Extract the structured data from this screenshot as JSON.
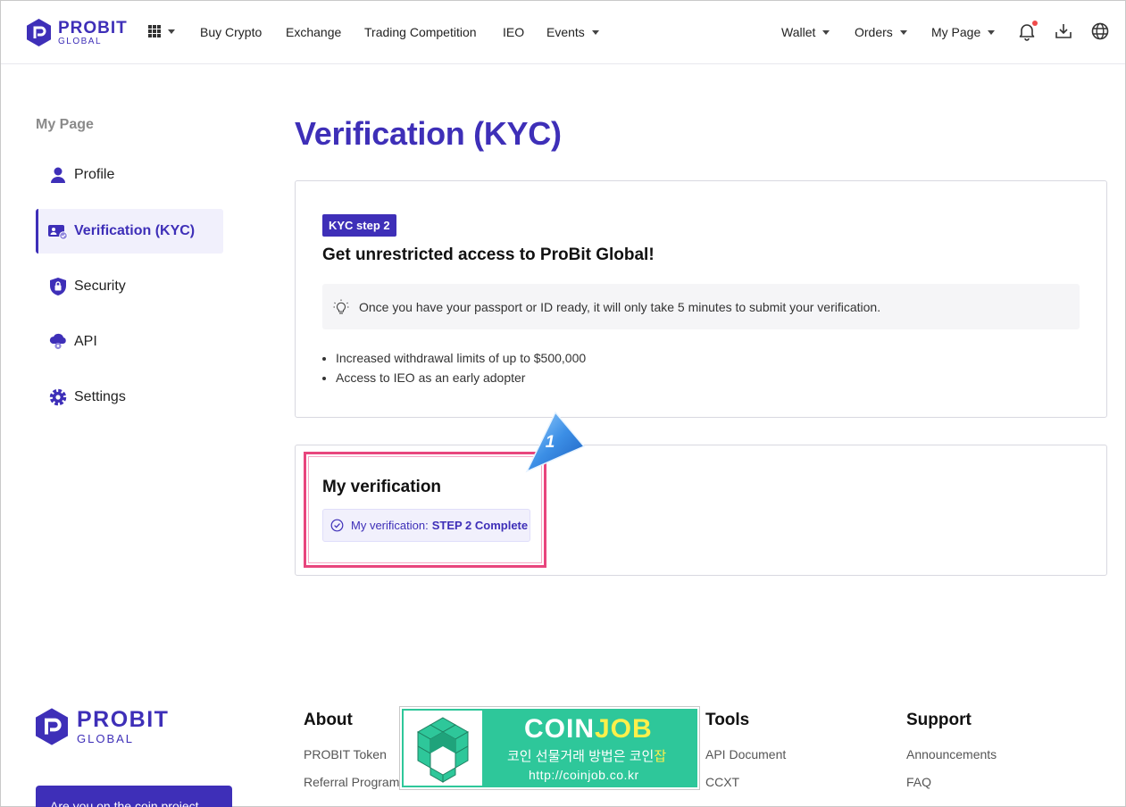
{
  "header": {
    "logo_main": "PROBIT",
    "logo_sub": "GLOBAL",
    "nav": [
      "Buy Crypto",
      "Exchange",
      "Trading Competition",
      "IEO",
      "Events"
    ],
    "right_nav": [
      "Wallet",
      "Orders",
      "My Page"
    ],
    "icons": [
      "apps-grid-icon",
      "bell-icon",
      "download-icon",
      "globe-icon"
    ]
  },
  "sidebar": {
    "title": "My Page",
    "items": [
      {
        "label": "Profile",
        "icon": "person-icon"
      },
      {
        "label": "Verification (KYC)",
        "icon": "id-card-icon",
        "active": true
      },
      {
        "label": "Security",
        "icon": "shield-lock-icon"
      },
      {
        "label": "API",
        "icon": "cloud-gear-icon"
      },
      {
        "label": "Settings",
        "icon": "gear-icon"
      }
    ]
  },
  "main": {
    "title": "Verification (KYC)",
    "kyc_card": {
      "badge": "KYC step 2",
      "heading": "Get unrestricted access to ProBit Global!",
      "tip": "Once you have your passport or ID ready, it will only take 5 minutes to submit your verification.",
      "bullets": [
        "Increased withdrawal limits of up to $500,000",
        "Access to IEO as an early adopter"
      ]
    },
    "my_verification": {
      "title": "My verification",
      "status_prefix": "My verification:",
      "status_value": "STEP 2 Complete"
    },
    "callout_number": "1"
  },
  "footer": {
    "logo_main": "PROBIT",
    "logo_sub": "GLOBAL",
    "cta": "Are you on the coin project...",
    "about": {
      "title": "About",
      "links": [
        "PROBIT Token",
        "Referral Program"
      ]
    },
    "tools": {
      "title": "Tools",
      "links": [
        "API Document",
        "CCXT"
      ]
    },
    "support": {
      "title": "Support",
      "links": [
        "Announcements",
        "FAQ"
      ]
    }
  },
  "banner": {
    "brand_a": "COIN",
    "brand_b": "JOB",
    "tagline_a": "코인 선물거래 방법은 코인",
    "tagline_b": "잡",
    "url": "http://coinjob.co.kr"
  },
  "colors": {
    "accent": "#3e2fb8",
    "highlight": "#e8457d",
    "banner": "#2ec79a"
  }
}
